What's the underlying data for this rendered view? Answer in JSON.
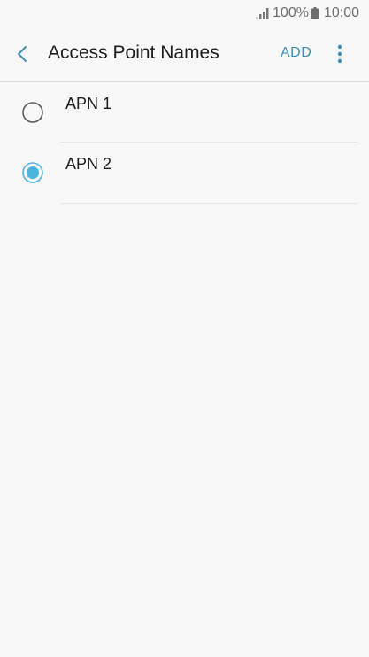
{
  "status_bar": {
    "battery_percent": "100%",
    "time": "10:00",
    "signal_icon": "signal-icon",
    "battery_icon": "battery-icon"
  },
  "header": {
    "back_icon": "chevron-left-icon",
    "title": "Access Point Names",
    "add_label": "ADD",
    "more_icon": "more-vert-icon"
  },
  "apn_list": [
    {
      "label": "APN 1",
      "selected": false
    },
    {
      "label": "APN 2",
      "selected": true
    }
  ],
  "colors": {
    "accent": "#3e8eb8",
    "radio_selected": "#4ab6e0",
    "radio_unselected": "#5a5a5a",
    "background": "#f8f8f8"
  }
}
